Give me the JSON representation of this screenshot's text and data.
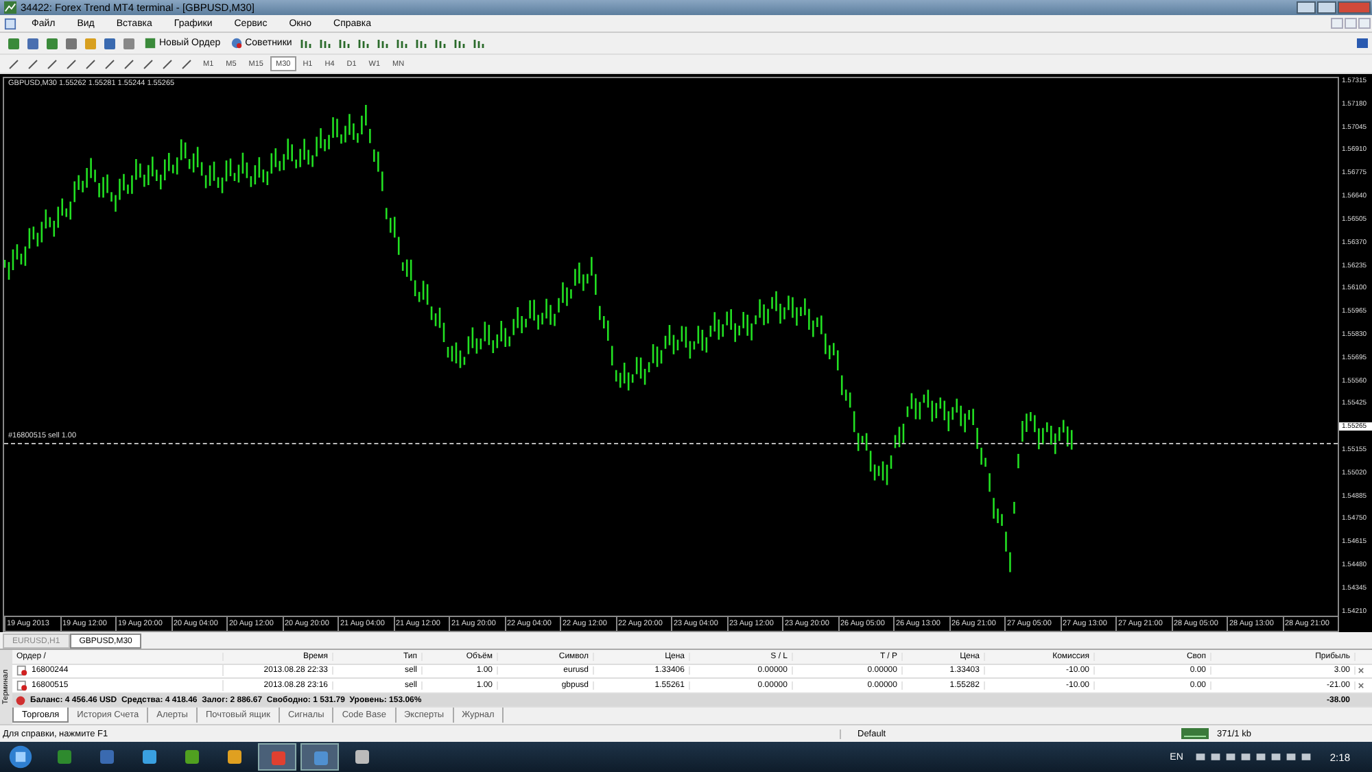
{
  "window": {
    "title": "34422: Forex Trend MT4 terminal - [GBPUSD,M30]"
  },
  "menu": [
    "Файл",
    "Вид",
    "Вставка",
    "Графики",
    "Сервис",
    "Окно",
    "Справка"
  ],
  "toolbar": {
    "new_order": "Новый Ордер",
    "experts": "Советники"
  },
  "timeframes": [
    {
      "label": "M1",
      "selected": false
    },
    {
      "label": "M5",
      "selected": false
    },
    {
      "label": "M15",
      "selected": false
    },
    {
      "label": "M30",
      "selected": true
    },
    {
      "label": "H1",
      "selected": false
    },
    {
      "label": "H4",
      "selected": false
    },
    {
      "label": "D1",
      "selected": false
    },
    {
      "label": "W1",
      "selected": false
    },
    {
      "label": "MN",
      "selected": false
    }
  ],
  "chart": {
    "header": "GBPUSD,M30  1.55262 1.55281 1.55244 1.55265",
    "order_line_label": "#16800515 sell 1.00",
    "price_labels": [
      {
        "text": "1.57315",
        "kind": "tick"
      },
      {
        "text": "1.57180",
        "kind": "tick"
      },
      {
        "text": "1.57045",
        "kind": "tick"
      },
      {
        "text": "1.56910",
        "kind": "tick"
      },
      {
        "text": "1.56775",
        "kind": "tick"
      },
      {
        "text": "1.56640",
        "kind": "tick"
      },
      {
        "text": "1.56505",
        "kind": "tick"
      },
      {
        "text": "1.56370",
        "kind": "tick"
      },
      {
        "text": "1.56235",
        "kind": "tick"
      },
      {
        "text": "1.56100",
        "kind": "tick"
      },
      {
        "text": "1.55965",
        "kind": "tick"
      },
      {
        "text": "1.55830",
        "kind": "tick"
      },
      {
        "text": "1.55695",
        "kind": "tick"
      },
      {
        "text": "1.55560",
        "kind": "tick"
      },
      {
        "text": "1.55425",
        "kind": "tick"
      },
      {
        "text": "1.55265",
        "kind": "current"
      },
      {
        "text": "1.55155",
        "kind": "tick"
      },
      {
        "text": "1.55020",
        "kind": "tick"
      },
      {
        "text": "1.54885",
        "kind": "tick"
      },
      {
        "text": "1.54750",
        "kind": "tick"
      },
      {
        "text": "1.54615",
        "kind": "tick"
      },
      {
        "text": "1.54480",
        "kind": "tick"
      },
      {
        "text": "1.54345",
        "kind": "tick"
      },
      {
        "text": "1.54210",
        "kind": "tick"
      }
    ],
    "time_labels": [
      "19 Aug 2013",
      "19 Aug 12:00",
      "19 Aug 20:00",
      "20 Aug 04:00",
      "20 Aug 12:00",
      "20 Aug 20:00",
      "21 Aug 04:00",
      "21 Aug 12:00",
      "21 Aug 20:00",
      "22 Aug 04:00",
      "22 Aug 12:00",
      "22 Aug 20:00",
      "23 Aug 04:00",
      "23 Aug 12:00",
      "23 Aug 20:00",
      "26 Aug 05:00",
      "26 Aug 13:00",
      "26 Aug 21:00",
      "27 Aug 05:00",
      "27 Aug 13:00",
      "27 Aug 21:00",
      "28 Aug 05:00",
      "28 Aug 13:00",
      "28 Aug 21:00"
    ]
  },
  "chart_tabs": [
    {
      "label": "EURUSD,H1",
      "selected": false
    },
    {
      "label": "GBPUSD,M30",
      "selected": true
    }
  ],
  "terminal": {
    "side_label": "Терминал",
    "columns": [
      "Ордер  /",
      "Время",
      "Тип",
      "Объём",
      "Символ",
      "Цена",
      "S / L",
      "T / P",
      "Цена",
      "Комиссия",
      "Своп",
      "Прибыль"
    ],
    "rows": [
      [
        "16800244",
        "2013.08.28 22:33",
        "sell",
        "1.00",
        "eurusd",
        "1.33406",
        "0.00000",
        "0.00000",
        "1.33403",
        "-10.00",
        "0.00",
        "3.00"
      ],
      [
        "16800515",
        "2013.08.28 23:16",
        "sell",
        "1.00",
        "gbpusd",
        "1.55261",
        "0.00000",
        "0.00000",
        "1.55282",
        "-10.00",
        "0.00",
        "-21.00"
      ]
    ],
    "summary": "Баланс: 4 456.46 USD  Средства: 4 418.46  Залог: 2 886.67  Свободно: 1 531.79  Уровень: 153.06%",
    "summary_profit": "-38.00",
    "tabs": [
      {
        "label": "Торговля",
        "selected": true
      },
      {
        "label": "История Счета",
        "selected": false
      },
      {
        "label": "Алерты",
        "selected": false
      },
      {
        "label": "Почтовый ящик",
        "selected": false
      },
      {
        "label": "Сигналы",
        "selected": false
      },
      {
        "label": "Code Base",
        "selected": false
      },
      {
        "label": "Эксперты",
        "selected": false
      },
      {
        "label": "Журнал",
        "selected": false
      }
    ]
  },
  "status_bar": {
    "help": "Для справки, нажмите F1",
    "profile": "Default",
    "traffic": "371/1 kb"
  },
  "taskbar": {
    "language": "EN",
    "time": "2:18"
  }
}
